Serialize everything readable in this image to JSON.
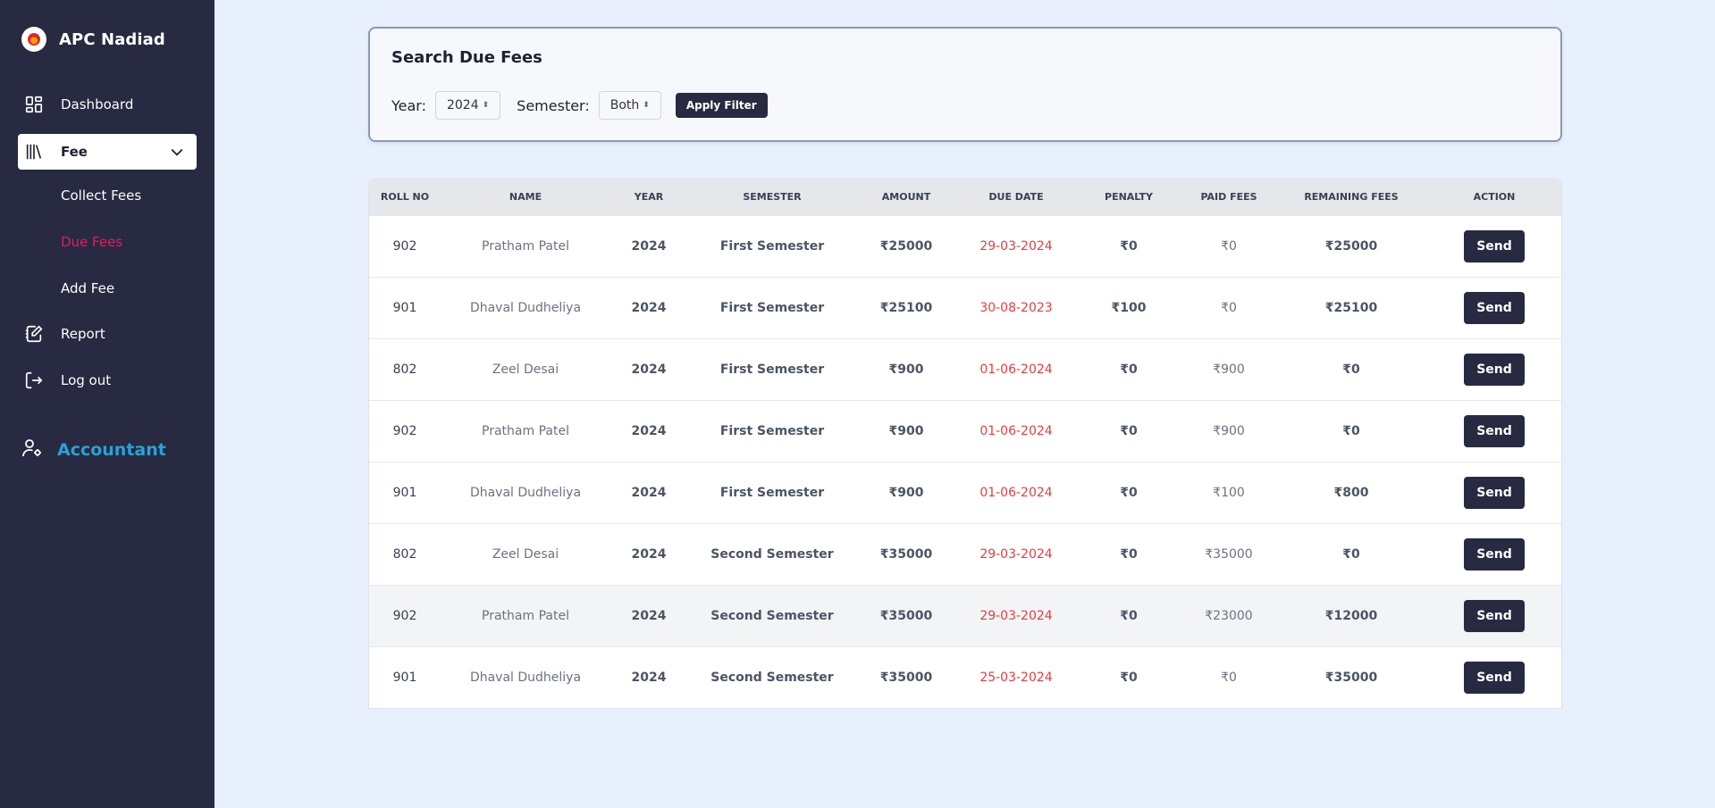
{
  "app": {
    "title": "APC Nadiad"
  },
  "sidebar": {
    "items": [
      {
        "label": "Dashboard",
        "icon": "dashboard-icon"
      },
      {
        "label": "Fee",
        "icon": "books-icon",
        "active": true
      },
      {
        "label": "Report",
        "icon": "report-icon"
      },
      {
        "label": "Log out",
        "icon": "logout-icon"
      }
    ],
    "fee_submenu": [
      "Collect Fees",
      "Due Fees",
      "Add Fee"
    ],
    "current_submenu": "Due Fees",
    "role": "Accountant"
  },
  "search": {
    "heading": "Search Due Fees",
    "year_label": "Year:",
    "year_value": "2024",
    "semester_label": "Semester:",
    "semester_value": "Both",
    "apply_label": "Apply Filter"
  },
  "table": {
    "headers": [
      "ROLL NO",
      "NAME",
      "YEAR",
      "SEMESTER",
      "AMOUNT",
      "DUE DATE",
      "PENALTY",
      "PAID FEES",
      "REMAINING FEES",
      "ACTION"
    ],
    "action_label": "Send",
    "rows": [
      {
        "roll": "902",
        "name": "Pratham Patel",
        "year": "2024",
        "semester": "First Semester",
        "amount": "₹25000",
        "due": "29-03-2024",
        "penalty": "₹0",
        "paid": "₹0",
        "remaining": "₹25000"
      },
      {
        "roll": "901",
        "name": "Dhaval Dudheliya",
        "year": "2024",
        "semester": "First Semester",
        "amount": "₹25100",
        "due": "30-08-2023",
        "penalty": "₹100",
        "paid": "₹0",
        "remaining": "₹25100"
      },
      {
        "roll": "802",
        "name": "Zeel Desai",
        "year": "2024",
        "semester": "First Semester",
        "amount": "₹900",
        "due": "01-06-2024",
        "penalty": "₹0",
        "paid": "₹900",
        "remaining": "₹0"
      },
      {
        "roll": "902",
        "name": "Pratham Patel",
        "year": "2024",
        "semester": "First Semester",
        "amount": "₹900",
        "due": "01-06-2024",
        "penalty": "₹0",
        "paid": "₹900",
        "remaining": "₹0"
      },
      {
        "roll": "901",
        "name": "Dhaval Dudheliya",
        "year": "2024",
        "semester": "First Semester",
        "amount": "₹900",
        "due": "01-06-2024",
        "penalty": "₹0",
        "paid": "₹100",
        "remaining": "₹800"
      },
      {
        "roll": "802",
        "name": "Zeel Desai",
        "year": "2024",
        "semester": "Second Semester",
        "amount": "₹35000",
        "due": "29-03-2024",
        "penalty": "₹0",
        "paid": "₹35000",
        "remaining": "₹0"
      },
      {
        "roll": "902",
        "name": "Pratham Patel",
        "year": "2024",
        "semester": "Second Semester",
        "amount": "₹35000",
        "due": "29-03-2024",
        "penalty": "₹0",
        "paid": "₹23000",
        "remaining": "₹12000"
      },
      {
        "roll": "901",
        "name": "Dhaval Dudheliya",
        "year": "2024",
        "semester": "Second Semester",
        "amount": "₹35000",
        "due": "25-03-2024",
        "penalty": "₹0",
        "paid": "₹0",
        "remaining": "₹35000"
      }
    ]
  },
  "colors": {
    "sidebar_bg": "#272a40",
    "page_bg": "#e9f0fd",
    "accent_pink": "#e11d66",
    "due_red": "#e53e3e",
    "role_blue": "#2aa1d8"
  }
}
